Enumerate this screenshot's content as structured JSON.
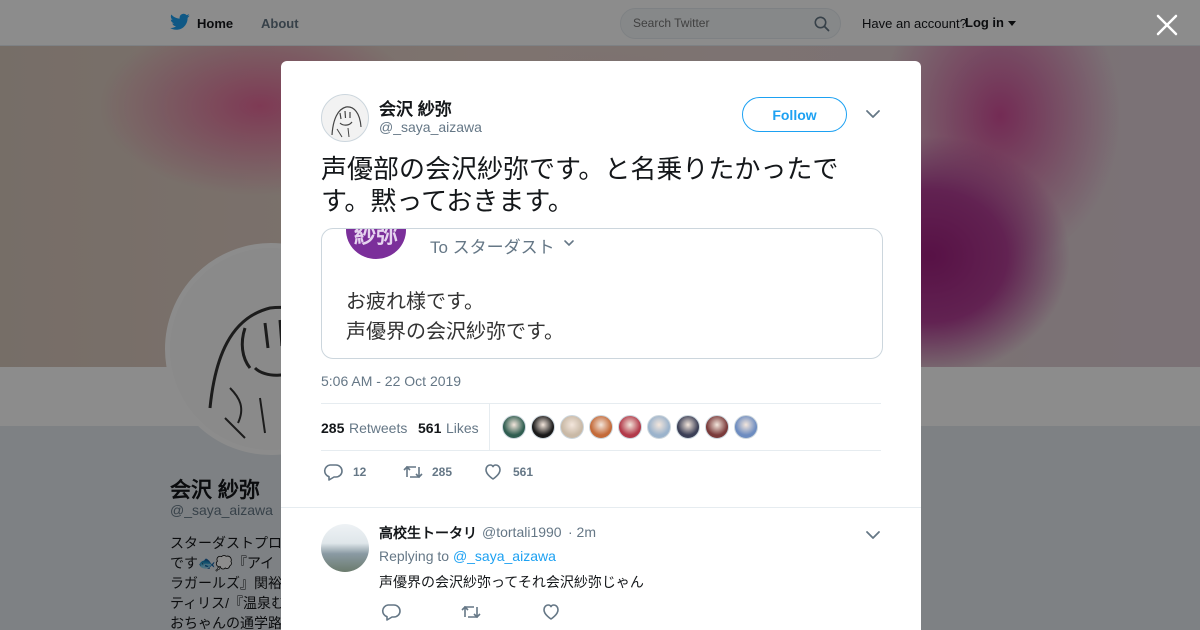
{
  "nav": {
    "home_label": "Home",
    "about_label": "About",
    "search_placeholder": "Search Twitter",
    "have_account": "Have an account?",
    "login_label": "Log in"
  },
  "profile": {
    "name": "会沢 紗弥",
    "handle": "@_saya_aizawa",
    "bio_lines": [
      "スターダストプロ",
      "です🐟💭『アイ",
      "ラガールズ』関裕",
      "ティリス/『温泉む",
      "おちゃんの通学路"
    ]
  },
  "tweet": {
    "author_name": "会沢 紗弥",
    "author_handle": "@_saya_aizawa",
    "follow_label": "Follow",
    "text": "声優部の会沢紗弥です。と名乗りたかったです。黙っておきます。",
    "quote": {
      "avatar_text": "紗弥",
      "to_label": "To スターダスト",
      "line1": "お疲れ様です。",
      "line2": "声優界の会沢紗弥です。"
    },
    "timestamp": "5:06 AM - 22 Oct 2019",
    "retweets_count": "285",
    "retweets_label": "Retweets",
    "likes_count": "561",
    "likes_label": "Likes",
    "replies_action": "12",
    "retweets_action": "285",
    "likes_action": "561",
    "liker_colors": [
      "#2f5d50",
      "#1a1a1a",
      "#c9b9a6",
      "#c46b3a",
      "#b23a4a",
      "#9bb3cc",
      "#3b3f56",
      "#7a3a3a",
      "#6d8cc0"
    ]
  },
  "reply": {
    "name": "高校生トータリ",
    "handle": "@tortali1990",
    "time": "· 2m",
    "replying_prefix": "Replying to",
    "replying_to": "@_saya_aizawa",
    "text": "声優界の会沢紗弥ってそれ会沢紗弥じゃん"
  },
  "colors": {
    "accent": "#1da1f2",
    "secondary_text": "#657786",
    "quote_avatar": "#7b2f9a"
  }
}
